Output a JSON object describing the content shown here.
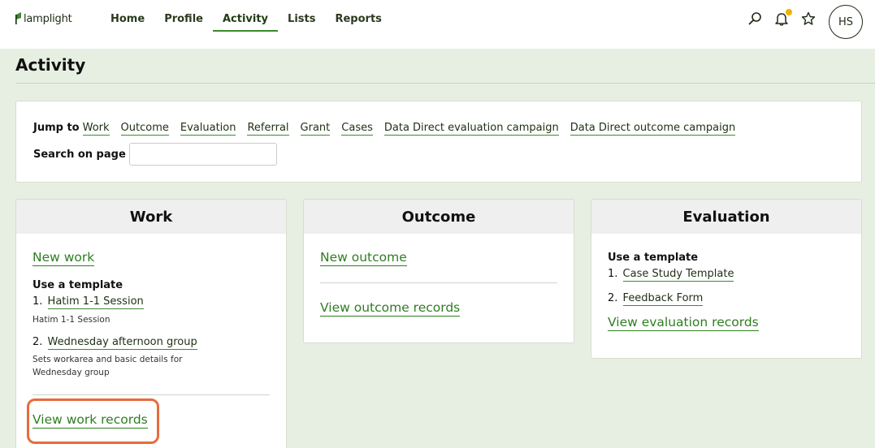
{
  "app": {
    "logo_text": "lamplight"
  },
  "nav": {
    "items": [
      {
        "label": "Home",
        "active": false
      },
      {
        "label": "Profile",
        "active": false
      },
      {
        "label": "Activity",
        "active": true
      },
      {
        "label": "Lists",
        "active": false
      },
      {
        "label": "Reports",
        "active": false
      }
    ]
  },
  "header_icons": [
    "search-icon",
    "bell-icon",
    "star-icon"
  ],
  "user": {
    "initials": "HS"
  },
  "page": {
    "title": "Activity"
  },
  "jump": {
    "label": "Jump to",
    "links": [
      "Work",
      "Outcome",
      "Evaluation",
      "Referral",
      "Grant",
      "Cases",
      "Data Direct evaluation campaign",
      "Data Direct outcome campaign"
    ],
    "search_label": "Search on page",
    "search_value": ""
  },
  "cards": {
    "work": {
      "title": "Work",
      "new_link": "New work",
      "template_title": "Use a template",
      "templates": [
        {
          "num": "1.",
          "name": "Hatim 1-1 Session",
          "desc": "Hatim 1-1 Session"
        },
        {
          "num": "2.",
          "name": "Wednesday afternoon group",
          "desc": "Sets workarea and basic details for Wednesday group"
        }
      ],
      "view_link": "View work records"
    },
    "outcome": {
      "title": "Outcome",
      "new_link": "New outcome",
      "view_link": "View outcome records"
    },
    "evaluation": {
      "title": "Evaluation",
      "template_title": "Use a template",
      "templates": [
        {
          "num": "1.",
          "name": "Case Study Template"
        },
        {
          "num": "2.",
          "name": "Feedback Form"
        }
      ],
      "view_link": "View evaluation records"
    }
  },
  "colors": {
    "accent": "#2f7d22",
    "highlight": "#e86c3a",
    "background": "#e7efe2",
    "notification": "#f2b200"
  }
}
